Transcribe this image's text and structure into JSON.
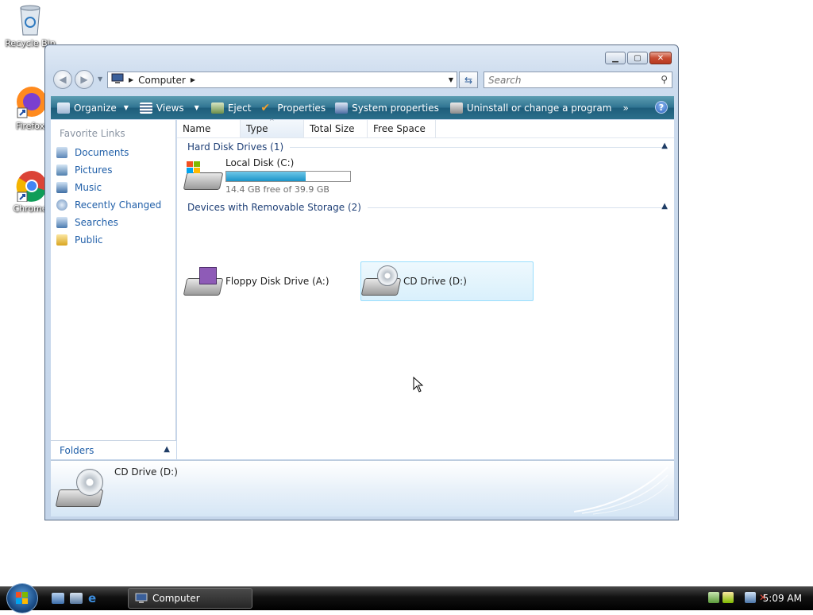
{
  "desktop": {
    "icons": [
      {
        "label": "Recycle Bin",
        "icon": "recycle-bin-icon"
      },
      {
        "label": "Firefox",
        "icon": "firefox-icon"
      },
      {
        "label": "Chrome",
        "icon": "chrome-icon"
      }
    ]
  },
  "window": {
    "caption_buttons": {
      "minimize": "minimize-icon",
      "maximize": "maximize-icon",
      "close": "close-icon"
    },
    "address": {
      "location": "Computer"
    },
    "search": {
      "placeholder": "Search"
    },
    "toolbar": {
      "organize": "Organize",
      "views": "Views",
      "eject": "Eject",
      "properties": "Properties",
      "system_properties": "System properties",
      "uninstall": "Uninstall or change a program",
      "more": "»",
      "help": "?"
    },
    "nav_pane": {
      "heading": "Favorite Links",
      "links": [
        "Documents",
        "Pictures",
        "Music",
        "Recently Changed",
        "Searches",
        "Public"
      ],
      "folders_label": "Folders"
    },
    "columns": [
      "Name",
      "Type",
      "Total Size",
      "Free Space"
    ],
    "groups": {
      "hard_disks": {
        "title": "Hard Disk Drives (1)",
        "drives": [
          {
            "name": "Local Disk (C:)",
            "free_text": "14.4 GB free of 39.9 GB",
            "used_fraction": 0.64
          }
        ]
      },
      "removable": {
        "title": "Devices with Removable Storage (2)",
        "drives": [
          {
            "name": "Floppy Disk Drive (A:)"
          },
          {
            "name": "CD Drive (D:)",
            "selected": true
          }
        ]
      }
    },
    "details_pane": {
      "title": "CD Drive (D:)"
    }
  },
  "taskbar": {
    "task_label": "Computer",
    "clock": "5:09 AM"
  },
  "colors": {
    "command_bar": "#2f7391",
    "link": "#205fa8",
    "capacity_fill": "#1b95c8",
    "selection": "#d9f0fc"
  }
}
